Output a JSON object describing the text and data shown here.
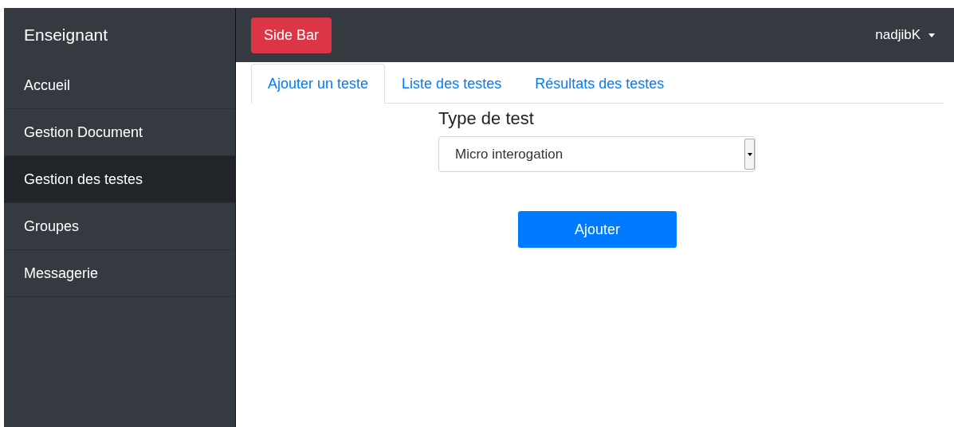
{
  "sidebar": {
    "title": "Enseignant",
    "items": [
      {
        "label": "Accueil",
        "selected": false
      },
      {
        "label": "Gestion Document",
        "selected": false
      },
      {
        "label": "Gestion des testes",
        "selected": true
      },
      {
        "label": "Groupes",
        "selected": false
      },
      {
        "label": "Messagerie",
        "selected": false
      }
    ]
  },
  "topbar": {
    "toggle_button": "Side Bar",
    "user_menu": "nadjibK"
  },
  "tabs": [
    {
      "label": "Ajouter un teste",
      "selected": true
    },
    {
      "label": "Liste des testes",
      "selected": false
    },
    {
      "label": "Résultats des testes",
      "selected": false
    }
  ],
  "form": {
    "label": "Type de test",
    "select_value": "Micro interogation",
    "submit_button": "Ajouter"
  }
}
